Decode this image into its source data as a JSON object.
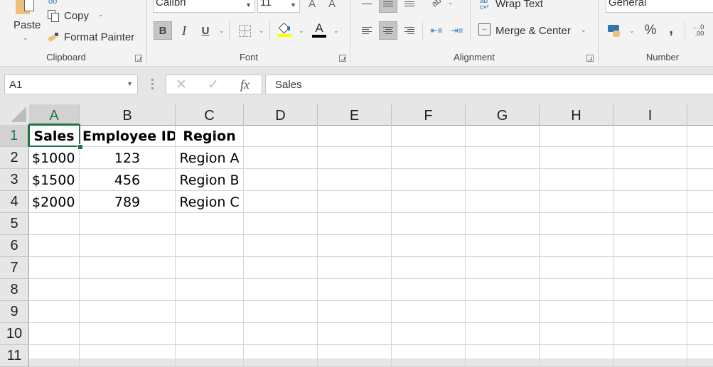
{
  "ribbon": {
    "clipboard": {
      "label": "Clipboard",
      "paste_label": "Paste",
      "copy_label": "Copy",
      "format_painter_label": "Format Painter"
    },
    "font": {
      "label": "Font",
      "font_name": "Calibri",
      "font_size": "11",
      "increase_font": "A",
      "decrease_font": "A",
      "bold": "B",
      "italic": "I",
      "underline": "U",
      "font_color_letter": "A",
      "fill_color": "#ffff00",
      "font_color": "#000000",
      "bold_active": true
    },
    "alignment": {
      "label": "Alignment",
      "wrap_text_label": "Wrap Text",
      "merge_center_label": "Merge & Center",
      "active_horizontal": "center",
      "active_vertical": "middle"
    },
    "number": {
      "label": "Number",
      "format": "General",
      "percent": "%",
      "comma": ",",
      "increase_decimal": "←.0 .00"
    }
  },
  "formula_bar": {
    "name_box": "A1",
    "cancel_icon": "✕",
    "enter_icon": "✓",
    "fx_label": "fx",
    "content": "Sales"
  },
  "grid": {
    "columns": [
      "A",
      "B",
      "C",
      "D",
      "E",
      "F",
      "G",
      "H",
      "I"
    ],
    "rows": [
      "1",
      "2",
      "3",
      "4",
      "5",
      "6",
      "7",
      "8",
      "9",
      "10",
      "11"
    ],
    "selected_cell": "A1",
    "cells": [
      [
        "Sales",
        "Employee ID",
        "Region"
      ],
      [
        "$1000",
        "123",
        "Region A"
      ],
      [
        "$1500",
        "456",
        "Region B"
      ],
      [
        "$2000",
        "789",
        "Region C"
      ]
    ]
  },
  "colors": {
    "accent": "#217346",
    "ribbon_bg": "#f3f3f3",
    "header_bg": "#e6e6e6"
  }
}
